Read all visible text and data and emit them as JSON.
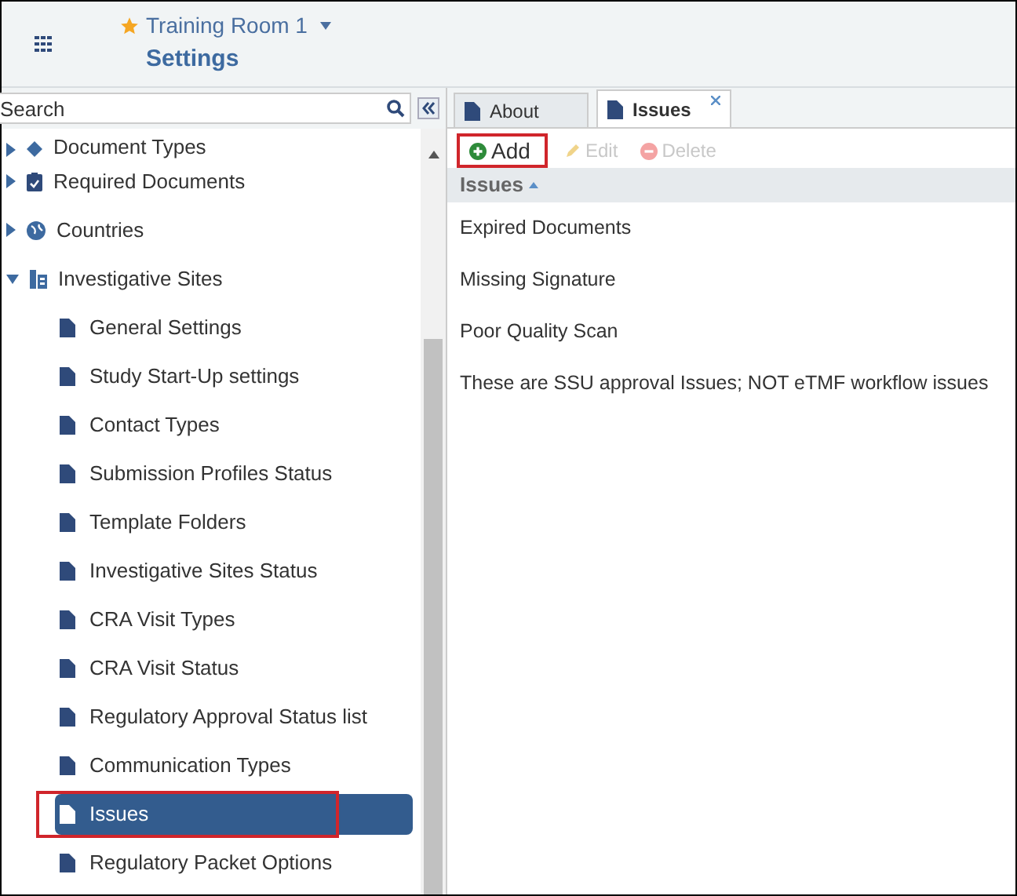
{
  "header": {
    "workspace": "Training Room 1",
    "title": "Settings"
  },
  "search": {
    "placeholder": "Search"
  },
  "tree": [
    {
      "label": "Document Types",
      "expanded": false
    },
    {
      "label": "Required Documents",
      "expanded": false
    },
    {
      "label": "Countries",
      "expanded": false
    },
    {
      "label": "Investigative Sites",
      "expanded": true,
      "children": [
        {
          "label": "General Settings",
          "selected": false,
          "highlighted": false
        },
        {
          "label": "Study Start-Up settings",
          "selected": false,
          "highlighted": false
        },
        {
          "label": "Contact Types",
          "selected": false,
          "highlighted": false
        },
        {
          "label": "Submission Profiles Status",
          "selected": false,
          "highlighted": false
        },
        {
          "label": "Template Folders",
          "selected": false,
          "highlighted": false
        },
        {
          "label": "Investigative Sites Status",
          "selected": false,
          "highlighted": false
        },
        {
          "label": "CRA Visit Types",
          "selected": false,
          "highlighted": false
        },
        {
          "label": "CRA Visit Status",
          "selected": false,
          "highlighted": false
        },
        {
          "label": "Regulatory Approval Status list",
          "selected": false,
          "highlighted": false
        },
        {
          "label": "Communication Types",
          "selected": false,
          "highlighted": false
        },
        {
          "label": "Issues",
          "selected": true,
          "highlighted": true
        },
        {
          "label": "Regulatory Packet Options",
          "selected": false,
          "highlighted": false
        }
      ]
    }
  ],
  "tabs": [
    {
      "label": "About",
      "selected": false,
      "closable": false
    },
    {
      "label": "Issues",
      "selected": true,
      "closable": true
    }
  ],
  "toolbar": [
    {
      "label": "Add",
      "kind": "add",
      "disabled": false,
      "highlighted": true
    },
    {
      "label": "Edit",
      "kind": "edit",
      "disabled": true,
      "highlighted": false
    },
    {
      "label": "Delete",
      "kind": "delete",
      "disabled": true,
      "highlighted": false
    }
  ],
  "table": {
    "column": "Issues",
    "rows": [
      "Expired Documents",
      "Missing Signature",
      "Poor Quality Scan",
      "These are SSU approval Issues; NOT eTMF workflow issues"
    ]
  }
}
